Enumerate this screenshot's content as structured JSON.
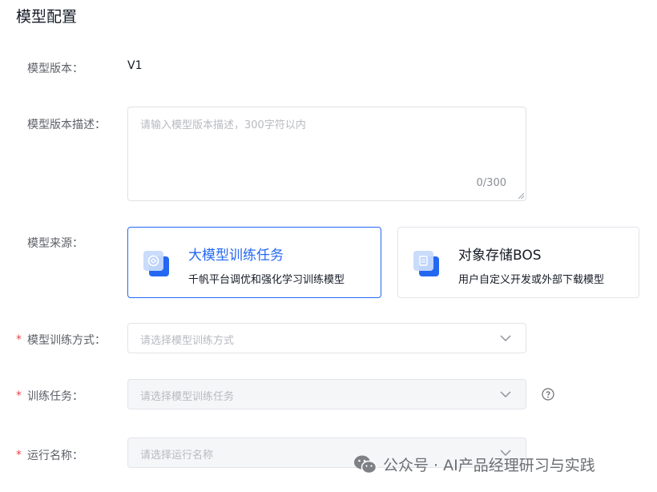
{
  "page_title": "模型配置",
  "form": {
    "version": {
      "label": "模型版本：",
      "value": "V1"
    },
    "description": {
      "label": "模型版本描述：",
      "placeholder": "请输入模型版本描述，300字符以内",
      "counter": "0/300"
    },
    "source": {
      "label": "模型来源：",
      "options": [
        {
          "title": "大模型训练任务",
          "desc": "千帆平台调优和强化学习训练模型",
          "selected": true,
          "icon": "training-task-icon"
        },
        {
          "title": "对象存储BOS",
          "desc": "用户自定义开发或外部下载模型",
          "selected": false,
          "icon": "bos-storage-icon"
        }
      ]
    },
    "training_method": {
      "required_mark": "*",
      "label": "模型训练方式：",
      "placeholder": "请选择模型训练方式"
    },
    "training_task": {
      "required_mark": "*",
      "label": "训练任务：",
      "placeholder": "请选择模型训练任务"
    },
    "run_name": {
      "required_mark": "*",
      "label": "运行名称：",
      "placeholder": "请选择运行名称"
    }
  },
  "watermark": {
    "text": "公众号 · AI产品经理研习与实践",
    "icon": "wechat-icon"
  },
  "colors": {
    "accent": "#2468f2",
    "required": "#e8464a"
  }
}
